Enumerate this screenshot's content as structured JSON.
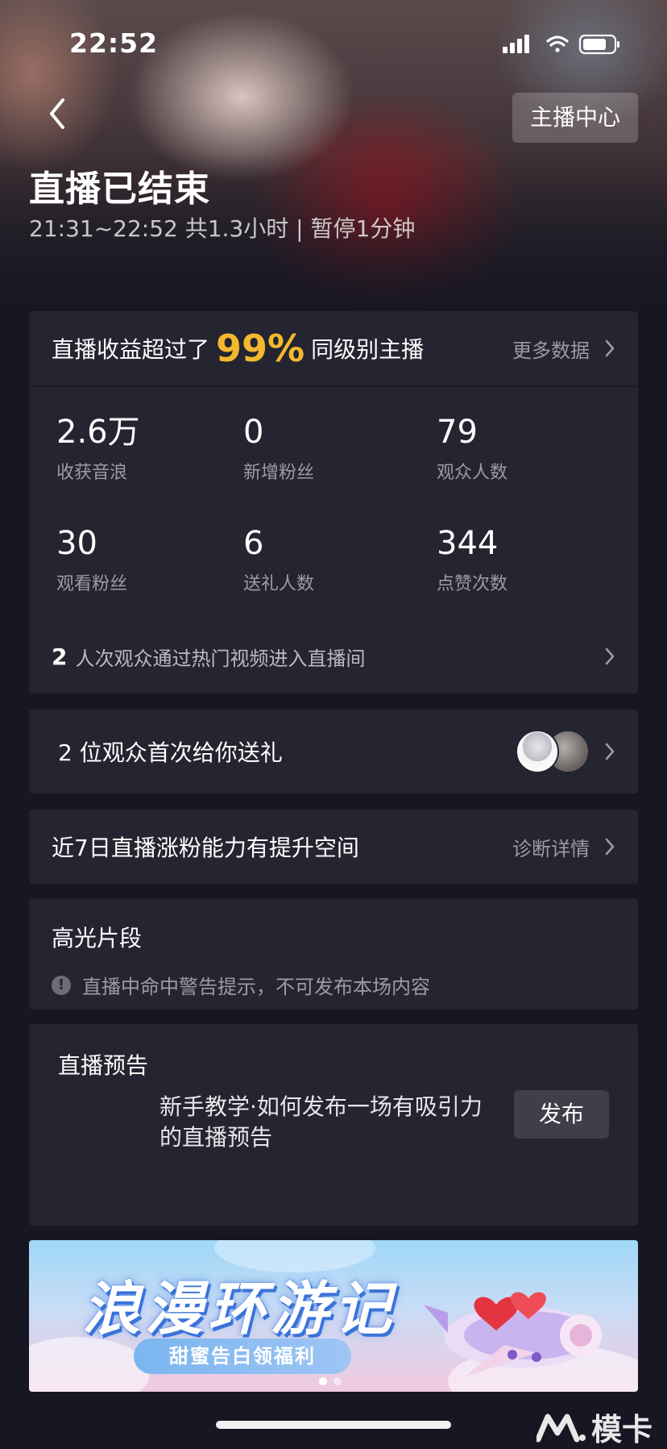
{
  "status_bar": {
    "time": "22:52"
  },
  "header": {
    "anchor_center_label": "主播中心",
    "title": "直播已结束",
    "subtitle": "21:31~22:52 共1.3小时 | 暂停1分钟"
  },
  "stats_card": {
    "prefix": "直播收益超过了",
    "percent": "99%",
    "suffix": "同级别主播",
    "percent_color": "#f4b82f",
    "more_label": "更多数据",
    "stats": [
      {
        "value": "2.6万",
        "label": "收获音浪"
      },
      {
        "value": "0",
        "label": "新增粉丝"
      },
      {
        "value": "79",
        "label": "观众人数"
      },
      {
        "value": "30",
        "label": "观看粉丝"
      },
      {
        "value": "6",
        "label": "送礼人数"
      },
      {
        "value": "344",
        "label": "点赞次数"
      }
    ],
    "hot_count": "2",
    "hot_text": "人次观众通过热门视频进入直播间"
  },
  "gift_row": {
    "label": "2 位观众首次给你送礼"
  },
  "growth_row": {
    "label": "近7日直播涨粉能力有提升空间",
    "action": "诊断详情"
  },
  "highlight": {
    "title": "高光片段",
    "warning": "直播中命中警告提示，不可发布本场内容"
  },
  "preview": {
    "title": "直播预告",
    "text": "新手教学·如何发布一场有吸引力的直播预告",
    "button": "发布"
  },
  "banner": {
    "title": "浪漫环游记",
    "subtitle": "甜蜜告白领福利"
  },
  "watermark": {
    "text": "模卡"
  },
  "icons": {
    "back": "chevron-left-icon",
    "chevron": "chevron-right-icon",
    "signal": "signal-icon",
    "wifi": "wifi-icon",
    "battery": "battery-icon",
    "warning": "warning-icon"
  }
}
